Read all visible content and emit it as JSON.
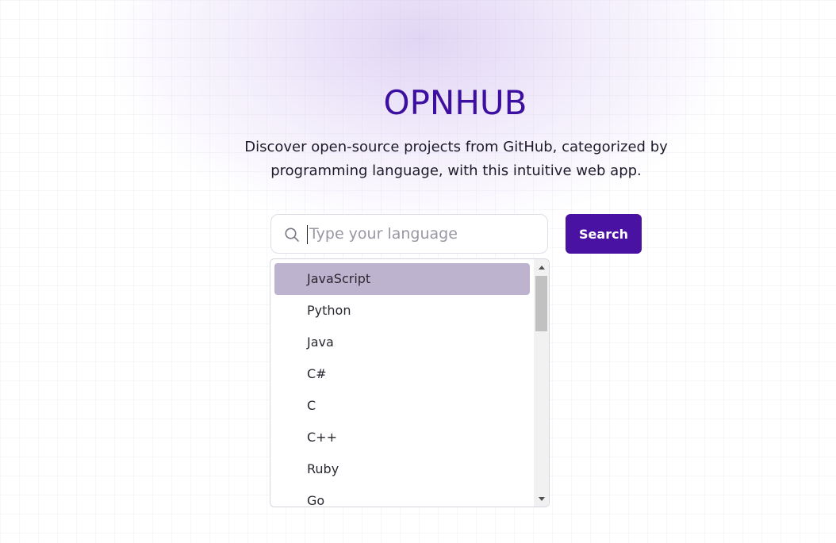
{
  "header": {
    "title": "OPNHUB",
    "subtitle": "Discover open-source projects from GitHub, categorized by programming language, with this intuitive web app."
  },
  "search": {
    "placeholder": "Type your language",
    "value": "",
    "button_label": "Search",
    "icon": "search-icon"
  },
  "dropdown": {
    "selected_index": 0,
    "items": [
      {
        "label": "JavaScript"
      },
      {
        "label": "Python"
      },
      {
        "label": "Java"
      },
      {
        "label": "C#"
      },
      {
        "label": "C"
      },
      {
        "label": "C++"
      },
      {
        "label": "Ruby"
      },
      {
        "label": "Go"
      }
    ]
  },
  "colors": {
    "brand": "#3d0fa0",
    "button": "#4a12a3",
    "selected_item": "#bdb3cf"
  }
}
